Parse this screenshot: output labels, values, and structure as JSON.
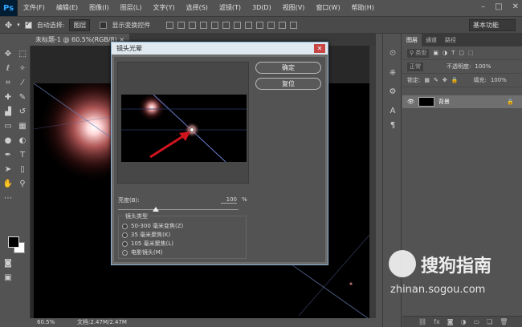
{
  "app": {
    "logo": "Ps"
  },
  "menu": [
    "文件(F)",
    "编辑(E)",
    "图像(I)",
    "图层(L)",
    "文字(Y)",
    "选择(S)",
    "滤镜(T)",
    "3D(D)",
    "视图(V)",
    "窗口(W)",
    "帮助(H)"
  ],
  "options": {
    "auto_select_label": "自动选择:",
    "auto_select_value": "图层",
    "show_transform_label": "显示变换控件",
    "workspace": "基本功能"
  },
  "document": {
    "tab_title": "未标题-1 @ 60.5%(RGB/8)",
    "zoom": "60.5%",
    "doc_info": "文档:2.47M/2.47M"
  },
  "layers_panel": {
    "tabs": [
      "图层",
      "通道",
      "路径"
    ],
    "filter_label": "类型",
    "blend_mode": "正常",
    "opacity_label": "不透明度:",
    "opacity_value": "100%",
    "lock_label": "锁定:",
    "fill_label": "填充:",
    "fill_value": "100%",
    "layer_name": "背景"
  },
  "dialog": {
    "title": "镜头光晕",
    "ok": "确定",
    "reset": "复位",
    "brightness_label": "亮度(B):",
    "brightness_value": "100",
    "brightness_unit": "%",
    "brightness_level": 100,
    "lens_type_label": "镜头类型",
    "lens_options": [
      "50-300 毫米变焦(Z)",
      "35 毫米聚焦(K)",
      "105 毫米聚焦(L)",
      "电影镜头(M)"
    ],
    "selected_lens": 3
  },
  "watermark": {
    "name": "搜狗指南",
    "url": "zhinan.sogou.com"
  },
  "colors": {
    "accent_arrow": "#d0141e",
    "dialog_border": "#8fb7d9",
    "flare": "#ff7a7a"
  }
}
